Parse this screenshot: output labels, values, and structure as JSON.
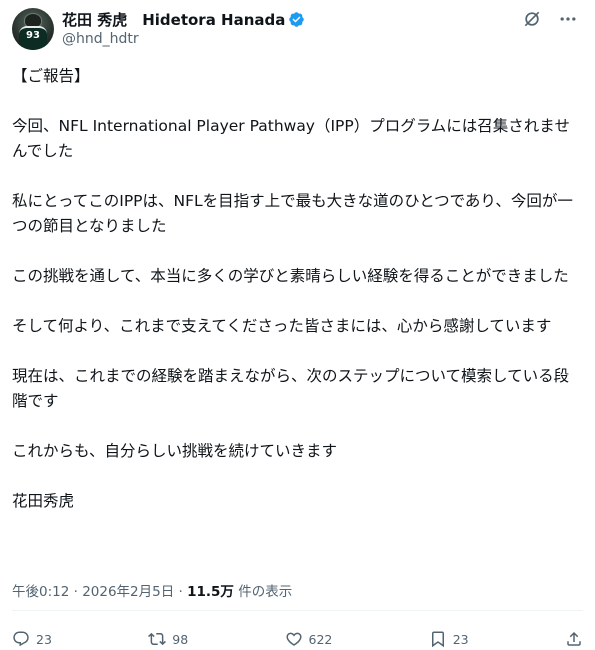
{
  "post": {
    "display_name": "花田 秀虎　Hidetora Hanada",
    "handle": "@hnd_hdtr",
    "avatar_number": "93",
    "paragraphs": [
      "【ご報告】",
      "今回、NFL International Player Pathway（IPP）プログラムには召集されませんでした",
      "私にとってこのIPPは、NFLを目指す上で最も大きな道のひとつであり、今回が一つの節目となりました",
      "この挑戦を通して、本当に多くの学びと素晴らしい経験を得ることができました",
      "そして何より、これまで支えてくださった皆さまには、心から感謝しています",
      "現在は、これまでの経験を踏まえながら、次のステップについて模索している段階です",
      "これからも、自分らしい挑戦を続けていきます",
      "花田秀虎"
    ],
    "timestamp": "午後0:12 · 2026年2月5日 · ",
    "views_count": "11.5万",
    "views_label": " 件の表示"
  },
  "actions": {
    "replies": "23",
    "reposts": "98",
    "likes": "622",
    "bookmarks": "23"
  },
  "icons": {
    "verified": "verified-badge-icon",
    "grok": "grok-icon",
    "more": "more-icon"
  },
  "colors": {
    "text": "#0f1419",
    "secondary": "#536471",
    "verified": "#1d9bf0"
  }
}
